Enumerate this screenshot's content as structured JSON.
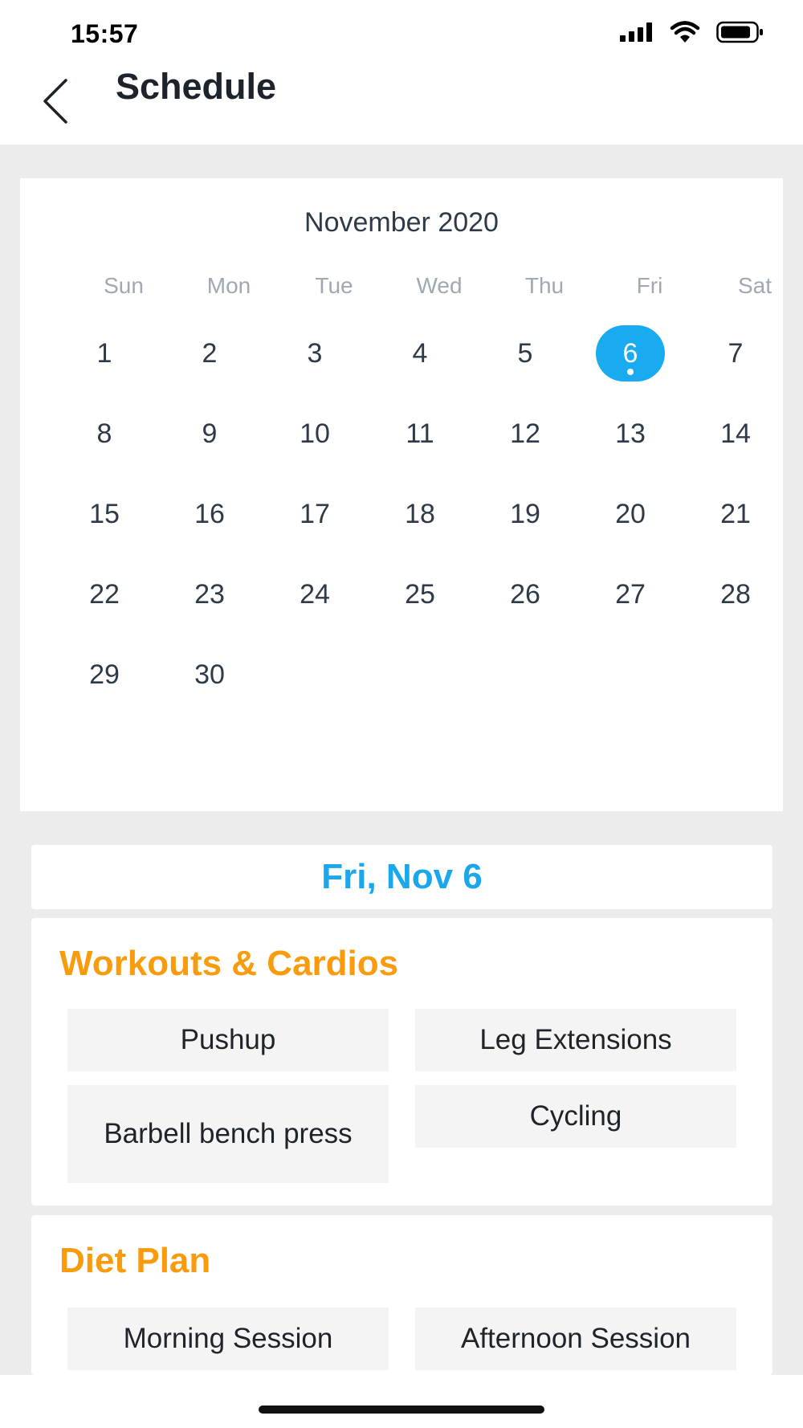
{
  "status_bar": {
    "time": "15:57",
    "icons": [
      "cellular-signal-icon",
      "wifi-icon",
      "battery-icon"
    ]
  },
  "header": {
    "back_icon": "chevron-left-icon",
    "title": "Schedule"
  },
  "calendar": {
    "month_label": "November 2020",
    "weekdays": [
      "Sun",
      "Mon",
      "Tue",
      "Wed",
      "Thu",
      "Fri",
      "Sat"
    ],
    "days": [
      "1",
      "2",
      "3",
      "4",
      "5",
      "6",
      "7",
      "8",
      "9",
      "10",
      "11",
      "12",
      "13",
      "14",
      "15",
      "16",
      "17",
      "18",
      "19",
      "20",
      "21",
      "22",
      "23",
      "24",
      "25",
      "26",
      "27",
      "28",
      "29",
      "30"
    ],
    "selected_day": "6",
    "selected_color": "#1aaaf0"
  },
  "selected_date": {
    "label": "Fri, Nov 6",
    "color": "#1aa7ec"
  },
  "workouts": {
    "title": "Workouts & Cardios",
    "title_color": "#f89b0d",
    "items": [
      "Pushup",
      "Leg Extensions",
      "Barbell bench press",
      "Cycling"
    ]
  },
  "diet": {
    "title": "Diet Plan",
    "title_color": "#f89b0d",
    "items": [
      "Morning Session",
      "Afternoon Session"
    ]
  }
}
